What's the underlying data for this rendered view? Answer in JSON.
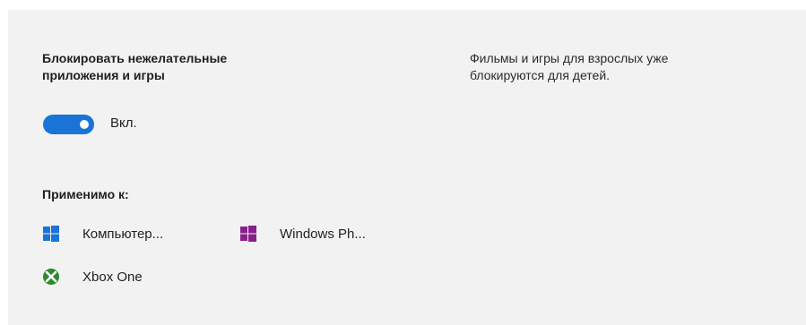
{
  "setting": {
    "heading_line1": "Блокировать нежелательные",
    "heading_line2": "приложения и игры",
    "toggle_state": "on",
    "toggle_label": "Вкл.",
    "accent_color": "#1a73d6"
  },
  "description": {
    "line1": "Фильмы и игры для взрослых уже",
    "line2": "блокируются для детей."
  },
  "applies_to": {
    "label": "Применимо к:",
    "devices": [
      {
        "icon": "windows-icon",
        "color": "#1a73d6",
        "label": "Компьютер..."
      },
      {
        "icon": "windows-icon",
        "color": "#8a1f8a",
        "label": "Windows Ph..."
      },
      {
        "icon": "xbox-icon",
        "color": "#2f8a2f",
        "label": "Xbox One"
      }
    ]
  }
}
